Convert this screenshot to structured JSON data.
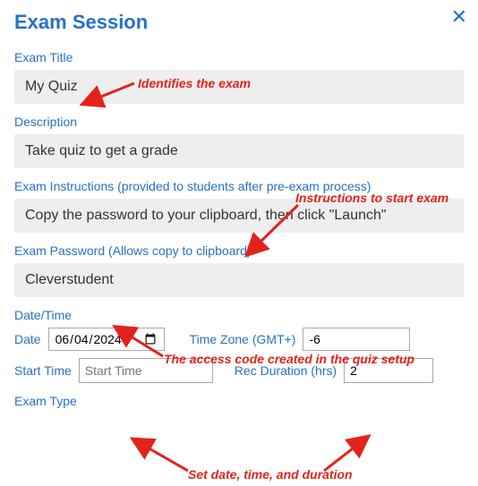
{
  "dialog": {
    "title": "Exam Session",
    "close_glyph": "✕"
  },
  "fields": {
    "exam_title": {
      "label": "Exam Title",
      "value": "My Quiz"
    },
    "description": {
      "label": "Description",
      "value": "Take quiz to get a grade"
    },
    "instructions": {
      "label": "Exam Instructions (provided to students after pre-exam process)",
      "value": "Copy the password to your clipboard, then click \"Launch\""
    },
    "password": {
      "label": "Exam Password (Allows copy to clipboard)",
      "value": "Cleverstudent"
    },
    "datetime": {
      "section_label": "Date/Time",
      "date_label": "Date",
      "date_value": "2024-06-04",
      "tz_label": "Time Zone (GMT+)",
      "tz_value": "-6",
      "start_time_label": "Start Time",
      "start_time_placeholder": "Start Time",
      "duration_label": "Rec Duration (hrs)",
      "duration_value": "2"
    },
    "exam_type": {
      "label": "Exam Type"
    }
  },
  "annotations": {
    "a1": "Identifies the exam",
    "a2": "Instructions to start exam",
    "a3": "The access code created in the quiz setup",
    "a4": "Set date, time, and duration"
  },
  "colors": {
    "accent": "#2571c8",
    "callout": "#e3221b"
  }
}
